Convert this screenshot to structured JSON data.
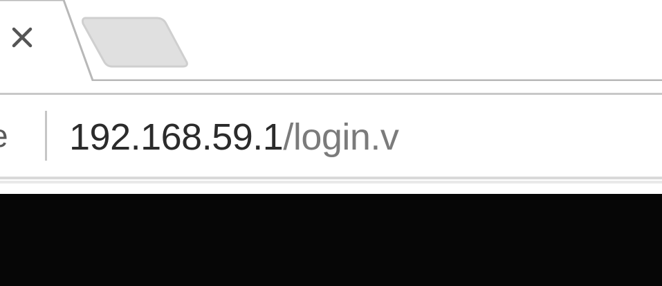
{
  "browser": {
    "tab": {
      "close_icon": "close-icon"
    },
    "new_tab_icon": "new-tab-icon",
    "omnibox": {
      "security_text": "e",
      "url_host": "192.168.59.1",
      "url_path": "/login.v"
    }
  },
  "colors": {
    "page_background": "#060606",
    "url_host": "#2b2b2b",
    "url_path": "#7b7b7b"
  }
}
